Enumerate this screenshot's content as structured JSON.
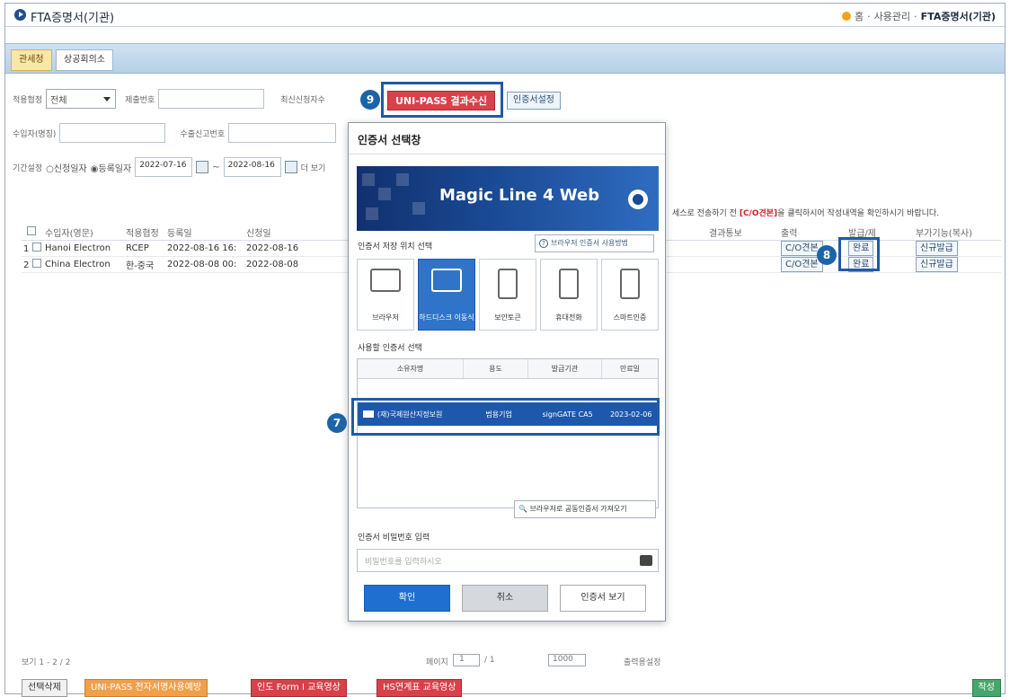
{
  "window": {
    "title": "FTA증명서(기관)",
    "breadcrumb": [
      "홈",
      "사용관리",
      "FTA증명서(기관)"
    ]
  },
  "tabs": [
    {
      "label": "관세청",
      "active": true
    },
    {
      "label": "상공회의소",
      "active": false
    }
  ],
  "search": {
    "type_label": "적용협정",
    "type_value": "전체",
    "doc_label": "제출번호",
    "rec_label": "최신신청자수",
    "importer_label": "수입자(명칭)",
    "issue_label": "수출신고번호",
    "period_label": "기간설정",
    "period_radio_1": "신청일자",
    "period_radio_2": "등록일자",
    "date_from": "2022-07-16",
    "date_to": "2022-08-16",
    "more_label": "더 보기"
  },
  "buttons": {
    "unipass": "UNI-PASS 결과수신",
    "cert_setting": "인증서설정"
  },
  "badges": {
    "b7": "7",
    "b8": "8",
    "b9": "9"
  },
  "notice": {
    "pre": "세스로 전송하기 전 ",
    "red": "[C/O견본]",
    "post": "을 클릭하시어 작성내역을 확인하시기 바랍니다."
  },
  "grid": {
    "headers": [
      "수입자(영문)",
      "적용협정",
      "등록일",
      "신청일",
      "결과통보",
      "출력",
      "발급/제",
      "부가기능(복사)"
    ],
    "rows": [
      {
        "num": "1",
        "importer": "Hanoi Electron",
        "fta": "RCEP",
        "reg": "2022-08-16 16:",
        "apply": "2022-08-16",
        "print": "C/O견본",
        "issue": "완료",
        "extra": "신규발급"
      },
      {
        "num": "2",
        "importer": "China Electron",
        "fta": "한-중국",
        "reg": "2022-08-08 00:",
        "apply": "2022-08-08",
        "print": "C/O견본",
        "issue": "완료",
        "extra": "신규발급"
      }
    ]
  },
  "pager": {
    "count": "보기 1 - 2 / 2",
    "page_label": "페이지",
    "page_value": "1",
    "page_total": "/ 1",
    "size": "1000",
    "setting": "출력용설정"
  },
  "bottom": {
    "select_delete": "선택삭제",
    "unipass_app": "UNI-PASS 전자서명사용예방",
    "form_video": "인도 Form I 교육영상",
    "hs_video": "HS연계표 교육영상",
    "write": "작성"
  },
  "modal": {
    "title": "인증서 선택창",
    "banner": "Magic Line 4 Web",
    "storage_label": "인증서 저장 위치 선택",
    "help": "브라우저 인증서 사용방법",
    "storage": [
      "브라우저",
      "하드디스크 이동식",
      "보안토큰",
      "휴대전화",
      "스마트인증"
    ],
    "select_label": "사용할 인증서 선택",
    "table_headers": [
      "소유자명",
      "용도",
      "발급기관",
      "만료일"
    ],
    "cert": {
      "owner": "(재)국제원산지정보원",
      "usage": "범용기업",
      "issuer": "signGATE CA5",
      "expiry": "2023-02-06"
    },
    "load_button": "브라우저로 공동인증서 가져오기",
    "pwd_label": "인증서 비밀번호 입력",
    "pwd_placeholder": "비밀번호를 입력하시오",
    "ok": "확인",
    "cancel": "취소",
    "view": "인증서 보기"
  }
}
